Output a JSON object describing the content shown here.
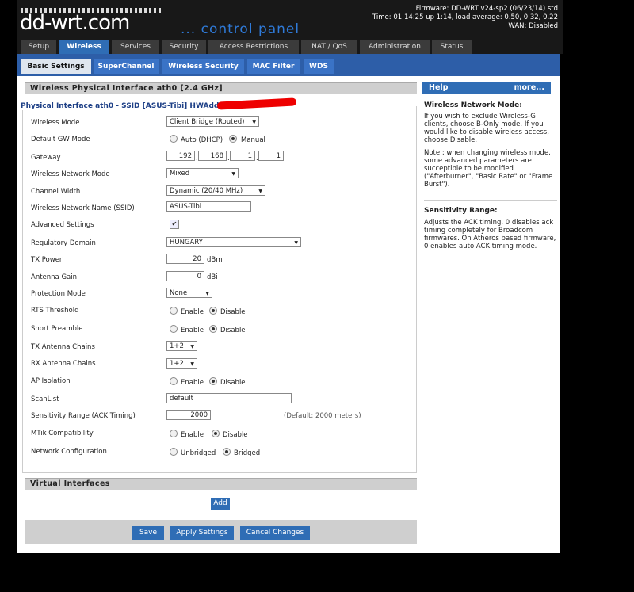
{
  "header": {
    "logo": "dd-wrt.com",
    "subtitle": "... control panel",
    "firmware": "Firmware: DD-WRT v24-sp2 (06/23/14) std",
    "time": "Time: 01:14:25 up 1:14, load average: 0.50, 0.32, 0.22",
    "wan": "WAN: Disabled"
  },
  "main_tabs": [
    "Setup",
    "Wireless",
    "Services",
    "Security",
    "Access Restrictions",
    "NAT / QoS",
    "Administration",
    "Status"
  ],
  "sub_tabs": [
    "Basic Settings",
    "SuperChannel",
    "Wireless Security",
    "MAC Filter",
    "WDS"
  ],
  "section_title": "Wireless Physical Interface ath0 [2.4 GHz]",
  "fieldset_title": "Physical Interface ath0 - SSID [ASUS-Tibi] HWAddr",
  "fields": {
    "wireless_mode": {
      "label": "Wireless Mode",
      "value": "Client Bridge (Routed)"
    },
    "default_gw_mode": {
      "label": "Default GW Mode",
      "opt1": "Auto (DHCP)",
      "opt2": "Manual"
    },
    "gateway": {
      "label": "Gateway",
      "o1": "192",
      "o2": "168",
      "o3": "1",
      "o4": "1"
    },
    "network_mode": {
      "label": "Wireless Network Mode",
      "value": "Mixed"
    },
    "channel_width": {
      "label": "Channel Width",
      "value": "Dynamic (20/40 MHz)"
    },
    "ssid": {
      "label": "Wireless Network Name (SSID)",
      "value": "ASUS-Tibi"
    },
    "advanced": {
      "label": "Advanced Settings"
    },
    "regulatory": {
      "label": "Regulatory Domain",
      "value": "HUNGARY"
    },
    "tx_power": {
      "label": "TX Power",
      "value": "20",
      "unit": "dBm"
    },
    "antenna_gain": {
      "label": "Antenna Gain",
      "value": "0",
      "unit": "dBi"
    },
    "protection": {
      "label": "Protection Mode",
      "value": "None"
    },
    "rts": {
      "label": "RTS Threshold"
    },
    "preamble": {
      "label": "Short Preamble"
    },
    "tx_chains": {
      "label": "TX Antenna Chains",
      "value": "1+2"
    },
    "rx_chains": {
      "label": "RX Antenna Chains",
      "value": "1+2"
    },
    "ap_isolation": {
      "label": "AP Isolation"
    },
    "scanlist": {
      "label": "ScanList",
      "value": "default"
    },
    "sensitivity": {
      "label": "Sensitivity Range (ACK Timing)",
      "value": "2000",
      "note": "(Default: 2000 meters)"
    },
    "mtik": {
      "label": "MTik Compatibility"
    },
    "net_config": {
      "label": "Network Configuration",
      "opt1": "Unbridged",
      "opt2": "Bridged"
    },
    "enable": "Enable",
    "disable": "Disable"
  },
  "virtual": {
    "title": "Virtual Interfaces",
    "add": "Add"
  },
  "buttons": {
    "save": "Save",
    "apply": "Apply Settings",
    "cancel": "Cancel Changes"
  },
  "help": {
    "title": "Help",
    "more": "more...",
    "h1": "Wireless Network Mode:",
    "t1a": "If you wish to exclude Wireless-G clients, choose B-Only mode. If you would like to disable wireless access, choose Disable.",
    "t1b": "Note : when changing wireless mode, some advanced parameters are succeptible to be modified (\"Afterburner\", \"Basic Rate\" or \"Frame Burst\").",
    "h2": "Sensitivity Range:",
    "t2": "Adjusts the ACK timing. 0 disables ack timing completely for Broadcom firmwares. On Atheros based firmware, 0 enables auto ACK timing mode."
  }
}
